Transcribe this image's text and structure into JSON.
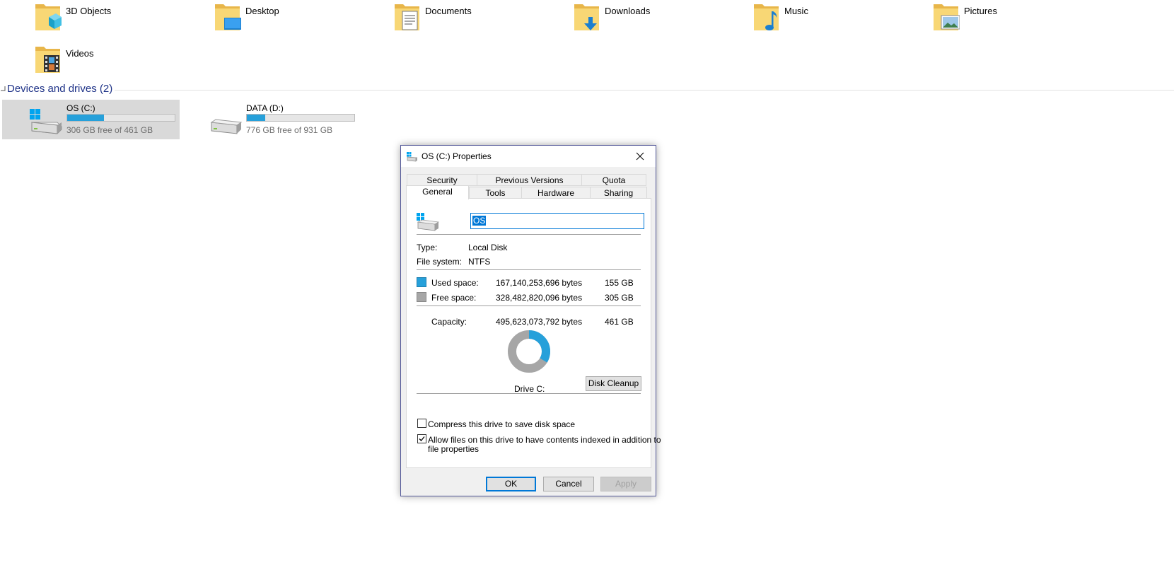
{
  "folders": [
    {
      "label": "3D Objects",
      "icon": "3d-objects-icon"
    },
    {
      "label": "Desktop",
      "icon": "desktop-icon"
    },
    {
      "label": "Documents",
      "icon": "documents-icon"
    },
    {
      "label": "Downloads",
      "icon": "downloads-icon"
    },
    {
      "label": "Music",
      "icon": "music-icon"
    },
    {
      "label": "Pictures",
      "icon": "pictures-icon"
    },
    {
      "label": "Videos",
      "icon": "videos-icon"
    }
  ],
  "devices": {
    "title": "Devices and drives (2)",
    "drives": [
      {
        "name": "OS (C:)",
        "free_text": "306 GB free of 461 GB",
        "used_fraction": 0.34,
        "selected": true
      },
      {
        "name": "DATA (D:)",
        "free_text": "776 GB free of 931 GB",
        "used_fraction": 0.17,
        "selected": false
      }
    ]
  },
  "dialog": {
    "title": "OS (C:) Properties",
    "tabs_top": [
      "Security",
      "Previous Versions",
      "Quota"
    ],
    "tabs_bottom": [
      "General",
      "Tools",
      "Hardware",
      "Sharing"
    ],
    "active_tab": "General",
    "name_value": "OS",
    "type_label": "Type:",
    "type_value": "Local Disk",
    "fs_label": "File system:",
    "fs_value": "NTFS",
    "used_label": "Used space:",
    "used_bytes": "167,140,253,696 bytes",
    "used_gb": "155 GB",
    "free_label": "Free space:",
    "free_bytes": "328,482,820,096 bytes",
    "free_gb": "305 GB",
    "capacity_label": "Capacity:",
    "capacity_bytes": "495,623,073,792 bytes",
    "capacity_gb": "461 GB",
    "used_fraction": 0.337,
    "drive_label": "Drive C:",
    "disk_cleanup": "Disk Cleanup",
    "compress_label": "Compress this drive to save disk space",
    "compress_checked": false,
    "index_label_line1": "Allow files on this drive to have contents indexed in addition to",
    "index_label_line2": "file properties",
    "index_checked": true,
    "ok": "OK",
    "cancel": "Cancel",
    "apply": "Apply",
    "colors": {
      "used": "#26a0da",
      "free": "#a6a6a6",
      "accent": "#0078d7"
    }
  }
}
